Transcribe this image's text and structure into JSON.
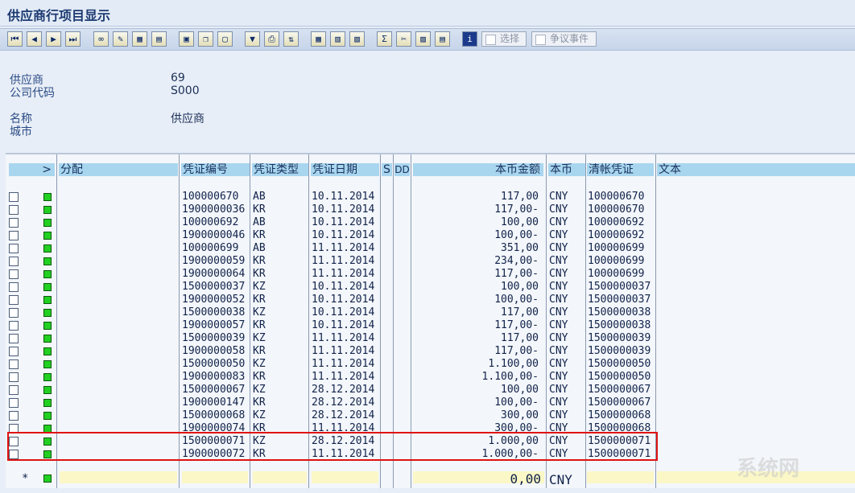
{
  "window": {
    "title": "供应商行项目显示"
  },
  "toolbar": {
    "icons": [
      "first-page",
      "previous-page",
      "next-page",
      "last-page",
      "choose-detail",
      "edit",
      "select-layout",
      "change-layout",
      "document-display",
      "copy",
      "print-preview",
      "filter",
      "print",
      "sort",
      "table-view",
      "columns",
      "subtotals",
      "sum",
      "export",
      "graphic",
      "abc",
      "info"
    ],
    "select_label": "选择",
    "dispute_label": "争议事件"
  },
  "header_info": {
    "vendor_label": "供应商",
    "vendor_value": "69",
    "company_label": "公司代码",
    "company_value": "S000",
    "name_label": "名称",
    "name_value": "供应商",
    "city_label": "城市",
    "city_value": ""
  },
  "table": {
    "columns": {
      "status": "",
      "assignment": "分配",
      "doc_no": "凭证编号",
      "doc_type": "凭证类型",
      "doc_date": "凭证日期",
      "s": "S",
      "dd": "DD",
      "amount": "本币金额",
      "currency": "本币",
      "clearing": "清帐凭证",
      "text": "文本"
    },
    "rows": [
      {
        "doc_no": "100000670",
        "type": "AB",
        "date": "10.11.2014",
        "amount": "117,00",
        "cur": "CNY",
        "clear": "100000670"
      },
      {
        "doc_no": "1900000036",
        "type": "KR",
        "date": "10.11.2014",
        "amount": "117,00-",
        "cur": "CNY",
        "clear": "100000670"
      },
      {
        "doc_no": "100000692",
        "type": "AB",
        "date": "10.11.2014",
        "amount": "100,00",
        "cur": "CNY",
        "clear": "100000692"
      },
      {
        "doc_no": "1900000046",
        "type": "KR",
        "date": "10.11.2014",
        "amount": "100,00-",
        "cur": "CNY",
        "clear": "100000692"
      },
      {
        "doc_no": "100000699",
        "type": "AB",
        "date": "11.11.2014",
        "amount": "351,00",
        "cur": "CNY",
        "clear": "100000699"
      },
      {
        "doc_no": "1900000059",
        "type": "KR",
        "date": "11.11.2014",
        "amount": "234,00-",
        "cur": "CNY",
        "clear": "100000699"
      },
      {
        "doc_no": "1900000064",
        "type": "KR",
        "date": "11.11.2014",
        "amount": "117,00-",
        "cur": "CNY",
        "clear": "100000699"
      },
      {
        "doc_no": "1500000037",
        "type": "KZ",
        "date": "10.11.2014",
        "amount": "100,00",
        "cur": "CNY",
        "clear": "1500000037"
      },
      {
        "doc_no": "1900000052",
        "type": "KR",
        "date": "10.11.2014",
        "amount": "100,00-",
        "cur": "CNY",
        "clear": "1500000037"
      },
      {
        "doc_no": "1500000038",
        "type": "KZ",
        "date": "10.11.2014",
        "amount": "117,00",
        "cur": "CNY",
        "clear": "1500000038"
      },
      {
        "doc_no": "1900000057",
        "type": "KR",
        "date": "10.11.2014",
        "amount": "117,00-",
        "cur": "CNY",
        "clear": "1500000038"
      },
      {
        "doc_no": "1500000039",
        "type": "KZ",
        "date": "11.11.2014",
        "amount": "117,00",
        "cur": "CNY",
        "clear": "1500000039"
      },
      {
        "doc_no": "1900000058",
        "type": "KR",
        "date": "11.11.2014",
        "amount": "117,00-",
        "cur": "CNY",
        "clear": "1500000039"
      },
      {
        "doc_no": "1500000050",
        "type": "KZ",
        "date": "11.11.2014",
        "amount": "1.100,00",
        "cur": "CNY",
        "clear": "1500000050"
      },
      {
        "doc_no": "1900000083",
        "type": "KR",
        "date": "11.11.2014",
        "amount": "1.100,00-",
        "cur": "CNY",
        "clear": "1500000050"
      },
      {
        "doc_no": "1500000067",
        "type": "KZ",
        "date": "28.12.2014",
        "amount": "100,00",
        "cur": "CNY",
        "clear": "1500000067"
      },
      {
        "doc_no": "1900000147",
        "type": "KR",
        "date": "28.12.2014",
        "amount": "100,00-",
        "cur": "CNY",
        "clear": "1500000067"
      },
      {
        "doc_no": "1500000068",
        "type": "KZ",
        "date": "28.12.2014",
        "amount": "300,00",
        "cur": "CNY",
        "clear": "1500000068"
      },
      {
        "doc_no": "1900000074",
        "type": "KR",
        "date": "11.11.2014",
        "amount": "300,00-",
        "cur": "CNY",
        "clear": "1500000068"
      },
      {
        "doc_no": "1500000071",
        "type": "KZ",
        "date": "28.12.2014",
        "amount": "1.000,00",
        "cur": "CNY",
        "clear": "1500000071"
      },
      {
        "doc_no": "1900000072",
        "type": "KR",
        "date": "11.11.2014",
        "amount": "1.000,00-",
        "cur": "CNY",
        "clear": "1500000071"
      }
    ],
    "total": {
      "marker": "*",
      "amount": "0,00",
      "cur": "CNY"
    }
  },
  "watermark": "系统网",
  "colors": {
    "accent": "#a9d6ef",
    "highlight": "#e01212",
    "led": "#22d022"
  }
}
